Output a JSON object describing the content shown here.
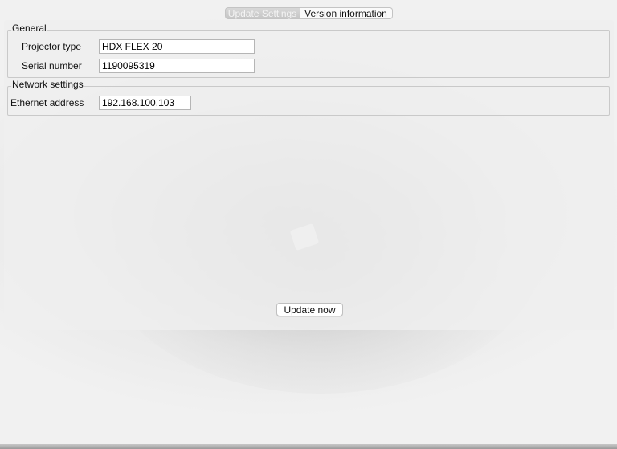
{
  "tabs": [
    {
      "label": "Update Settings",
      "active": true
    },
    {
      "label": "Version information",
      "active": false
    }
  ],
  "general": {
    "title": "General",
    "projector_type_label": "Projector type",
    "projector_type_value": "HDX FLEX 20",
    "serial_number_label": "Serial number",
    "serial_number_value": "1190095319"
  },
  "network": {
    "title": "Network settings",
    "ethernet_label": "Ethernet address",
    "ethernet_value": "192.168.100.103"
  },
  "actions": {
    "update_now_label": "Update now"
  }
}
